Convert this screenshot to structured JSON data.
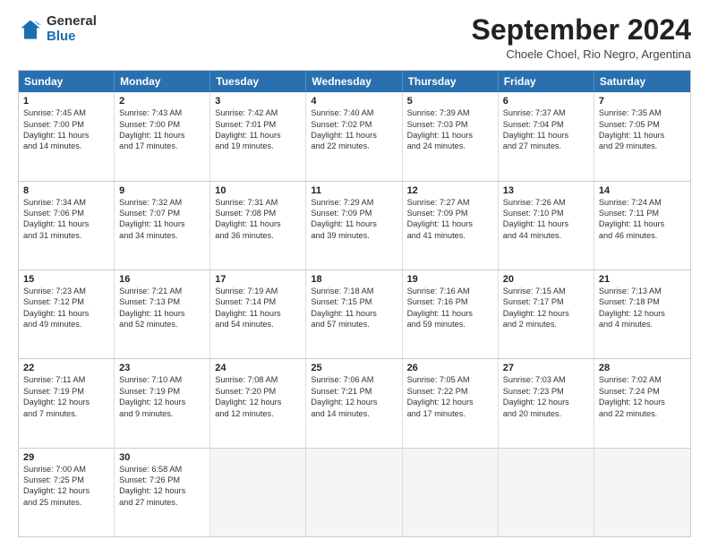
{
  "logo": {
    "general": "General",
    "blue": "Blue"
  },
  "title": "September 2024",
  "subtitle": "Choele Choel, Rio Negro, Argentina",
  "days": [
    "Sunday",
    "Monday",
    "Tuesday",
    "Wednesday",
    "Thursday",
    "Friday",
    "Saturday"
  ],
  "rows": [
    [
      {
        "day": "1",
        "lines": [
          "Sunrise: 7:45 AM",
          "Sunset: 7:00 PM",
          "Daylight: 11 hours",
          "and 14 minutes."
        ]
      },
      {
        "day": "2",
        "lines": [
          "Sunrise: 7:43 AM",
          "Sunset: 7:00 PM",
          "Daylight: 11 hours",
          "and 17 minutes."
        ]
      },
      {
        "day": "3",
        "lines": [
          "Sunrise: 7:42 AM",
          "Sunset: 7:01 PM",
          "Daylight: 11 hours",
          "and 19 minutes."
        ]
      },
      {
        "day": "4",
        "lines": [
          "Sunrise: 7:40 AM",
          "Sunset: 7:02 PM",
          "Daylight: 11 hours",
          "and 22 minutes."
        ]
      },
      {
        "day": "5",
        "lines": [
          "Sunrise: 7:39 AM",
          "Sunset: 7:03 PM",
          "Daylight: 11 hours",
          "and 24 minutes."
        ]
      },
      {
        "day": "6",
        "lines": [
          "Sunrise: 7:37 AM",
          "Sunset: 7:04 PM",
          "Daylight: 11 hours",
          "and 27 minutes."
        ]
      },
      {
        "day": "7",
        "lines": [
          "Sunrise: 7:35 AM",
          "Sunset: 7:05 PM",
          "Daylight: 11 hours",
          "and 29 minutes."
        ]
      }
    ],
    [
      {
        "day": "8",
        "lines": [
          "Sunrise: 7:34 AM",
          "Sunset: 7:06 PM",
          "Daylight: 11 hours",
          "and 31 minutes."
        ]
      },
      {
        "day": "9",
        "lines": [
          "Sunrise: 7:32 AM",
          "Sunset: 7:07 PM",
          "Daylight: 11 hours",
          "and 34 minutes."
        ]
      },
      {
        "day": "10",
        "lines": [
          "Sunrise: 7:31 AM",
          "Sunset: 7:08 PM",
          "Daylight: 11 hours",
          "and 36 minutes."
        ]
      },
      {
        "day": "11",
        "lines": [
          "Sunrise: 7:29 AM",
          "Sunset: 7:09 PM",
          "Daylight: 11 hours",
          "and 39 minutes."
        ]
      },
      {
        "day": "12",
        "lines": [
          "Sunrise: 7:27 AM",
          "Sunset: 7:09 PM",
          "Daylight: 11 hours",
          "and 41 minutes."
        ]
      },
      {
        "day": "13",
        "lines": [
          "Sunrise: 7:26 AM",
          "Sunset: 7:10 PM",
          "Daylight: 11 hours",
          "and 44 minutes."
        ]
      },
      {
        "day": "14",
        "lines": [
          "Sunrise: 7:24 AM",
          "Sunset: 7:11 PM",
          "Daylight: 11 hours",
          "and 46 minutes."
        ]
      }
    ],
    [
      {
        "day": "15",
        "lines": [
          "Sunrise: 7:23 AM",
          "Sunset: 7:12 PM",
          "Daylight: 11 hours",
          "and 49 minutes."
        ]
      },
      {
        "day": "16",
        "lines": [
          "Sunrise: 7:21 AM",
          "Sunset: 7:13 PM",
          "Daylight: 11 hours",
          "and 52 minutes."
        ]
      },
      {
        "day": "17",
        "lines": [
          "Sunrise: 7:19 AM",
          "Sunset: 7:14 PM",
          "Daylight: 11 hours",
          "and 54 minutes."
        ]
      },
      {
        "day": "18",
        "lines": [
          "Sunrise: 7:18 AM",
          "Sunset: 7:15 PM",
          "Daylight: 11 hours",
          "and 57 minutes."
        ]
      },
      {
        "day": "19",
        "lines": [
          "Sunrise: 7:16 AM",
          "Sunset: 7:16 PM",
          "Daylight: 11 hours",
          "and 59 minutes."
        ]
      },
      {
        "day": "20",
        "lines": [
          "Sunrise: 7:15 AM",
          "Sunset: 7:17 PM",
          "Daylight: 12 hours",
          "and 2 minutes."
        ]
      },
      {
        "day": "21",
        "lines": [
          "Sunrise: 7:13 AM",
          "Sunset: 7:18 PM",
          "Daylight: 12 hours",
          "and 4 minutes."
        ]
      }
    ],
    [
      {
        "day": "22",
        "lines": [
          "Sunrise: 7:11 AM",
          "Sunset: 7:19 PM",
          "Daylight: 12 hours",
          "and 7 minutes."
        ]
      },
      {
        "day": "23",
        "lines": [
          "Sunrise: 7:10 AM",
          "Sunset: 7:19 PM",
          "Daylight: 12 hours",
          "and 9 minutes."
        ]
      },
      {
        "day": "24",
        "lines": [
          "Sunrise: 7:08 AM",
          "Sunset: 7:20 PM",
          "Daylight: 12 hours",
          "and 12 minutes."
        ]
      },
      {
        "day": "25",
        "lines": [
          "Sunrise: 7:06 AM",
          "Sunset: 7:21 PM",
          "Daylight: 12 hours",
          "and 14 minutes."
        ]
      },
      {
        "day": "26",
        "lines": [
          "Sunrise: 7:05 AM",
          "Sunset: 7:22 PM",
          "Daylight: 12 hours",
          "and 17 minutes."
        ]
      },
      {
        "day": "27",
        "lines": [
          "Sunrise: 7:03 AM",
          "Sunset: 7:23 PM",
          "Daylight: 12 hours",
          "and 20 minutes."
        ]
      },
      {
        "day": "28",
        "lines": [
          "Sunrise: 7:02 AM",
          "Sunset: 7:24 PM",
          "Daylight: 12 hours",
          "and 22 minutes."
        ]
      }
    ],
    [
      {
        "day": "29",
        "lines": [
          "Sunrise: 7:00 AM",
          "Sunset: 7:25 PM",
          "Daylight: 12 hours",
          "and 25 minutes."
        ]
      },
      {
        "day": "30",
        "lines": [
          "Sunrise: 6:58 AM",
          "Sunset: 7:26 PM",
          "Daylight: 12 hours",
          "and 27 minutes."
        ]
      },
      {
        "day": "",
        "lines": []
      },
      {
        "day": "",
        "lines": []
      },
      {
        "day": "",
        "lines": []
      },
      {
        "day": "",
        "lines": []
      },
      {
        "day": "",
        "lines": []
      }
    ]
  ]
}
